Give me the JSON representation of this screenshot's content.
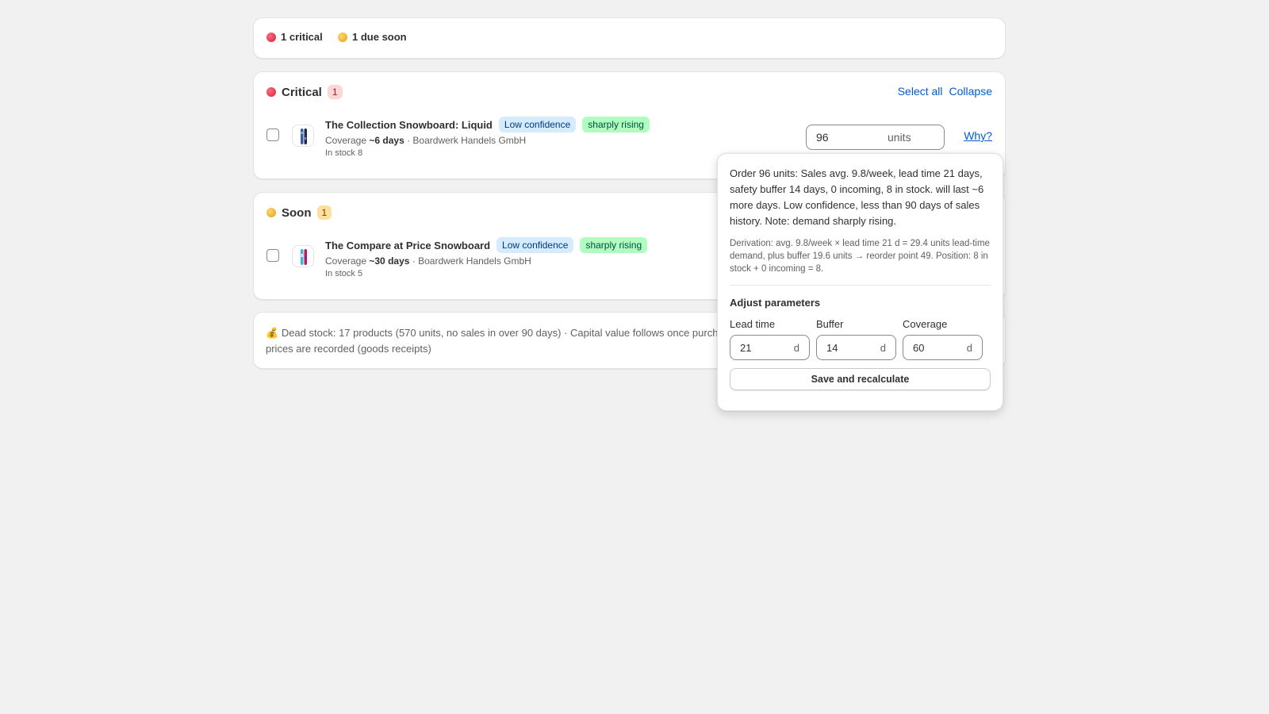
{
  "summary": {
    "critical_label": "1 critical",
    "due_soon_label": "1 due soon"
  },
  "sections": {
    "critical": {
      "title": "Critical",
      "count": "1",
      "select_all": "Select all",
      "collapse": "Collapse",
      "item": {
        "name": "The Collection Snowboard: Liquid",
        "confidence_tag": "Low confidence",
        "trend_tag": "sharply rising",
        "coverage_prefix": "Coverage",
        "coverage_value": "~6 days",
        "supplier": "· Boardwerk Handels GmbH",
        "stock": "In stock 8",
        "qty_value": "96",
        "qty_unit": "units",
        "why_label": "Why?"
      }
    },
    "soon": {
      "title": "Soon",
      "count": "1",
      "item": {
        "name": "The Compare at Price Snowboard",
        "confidence_tag": "Low confidence",
        "trend_tag": "sharply rising",
        "coverage_prefix": "Coverage",
        "coverage_value": "~30 days",
        "supplier": "· Boardwerk Handels GmbH",
        "stock": "In stock 5"
      }
    }
  },
  "deadstock": {
    "icon": "money-bag-icon",
    "text": "Dead stock: 17 products (570 units, no sales in over 90 days) · Capital value follows once purchase prices are recorded (goods receipts)"
  },
  "popover": {
    "explanation": "Order 96 units: Sales avg. 9.8/week, lead time 21 days, safety buffer 14 days, 0 incoming, 8 in stock. will last ~6 more days. Low confidence, less than 90 days of sales history. Note: demand sharply rising.",
    "derivation": "Derivation: avg. 9.8/week × lead time 21 d = 29.4 units lead-time demand, plus buffer 19.6 units → reorder point 49. Position: 8 in stock + 0 incoming = 8.",
    "adjust_heading": "Adjust parameters",
    "params": [
      {
        "label": "Lead time",
        "value": "21",
        "unit": "d"
      },
      {
        "label": "Buffer",
        "value": "14",
        "unit": "d"
      },
      {
        "label": "Coverage",
        "value": "60",
        "unit": "d"
      }
    ],
    "save_label": "Save and recalculate"
  },
  "colors": {
    "critical": "#d4213d",
    "soon": "#e0a21a",
    "link": "#005bd3",
    "tag_blue_bg": "#d5ebff",
    "tag_green_bg": "#affebf"
  }
}
